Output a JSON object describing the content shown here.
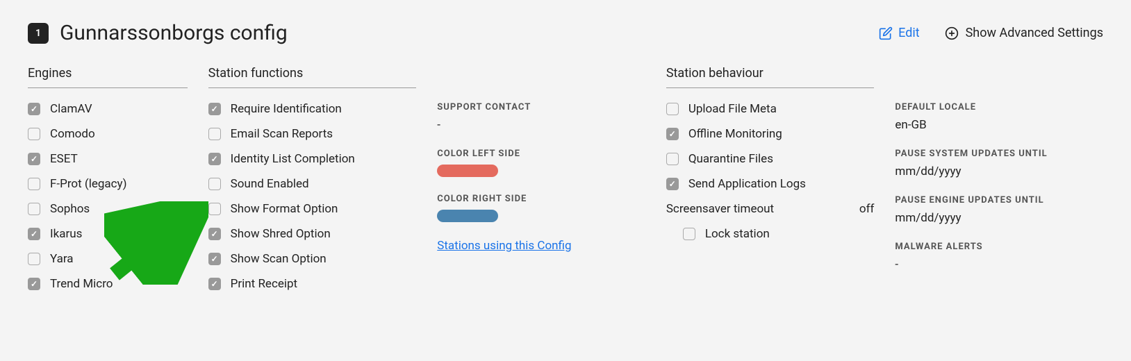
{
  "header": {
    "badge": "1",
    "title": "Gunnarssonborgs config",
    "edit_label": "Edit",
    "advanced_label": "Show Advanced Settings"
  },
  "engines": {
    "title": "Engines",
    "items": [
      {
        "label": "ClamAV",
        "checked": true
      },
      {
        "label": "Comodo",
        "checked": false
      },
      {
        "label": "ESET",
        "checked": true
      },
      {
        "label": "F-Prot (legacy)",
        "checked": false
      },
      {
        "label": "Sophos",
        "checked": false
      },
      {
        "label": "Ikarus",
        "checked": true
      },
      {
        "label": "Yara",
        "checked": false
      },
      {
        "label": "Trend Micro",
        "checked": true
      }
    ]
  },
  "functions": {
    "title": "Station functions",
    "items": [
      {
        "label": "Require Identification",
        "checked": true
      },
      {
        "label": "Email Scan Reports",
        "checked": false
      },
      {
        "label": "Identity List Completion",
        "checked": true
      },
      {
        "label": "Sound Enabled",
        "checked": false
      },
      {
        "label": "Show Format Option",
        "checked": false
      },
      {
        "label": "Show Shred Option",
        "checked": true
      },
      {
        "label": "Show Scan Option",
        "checked": true
      },
      {
        "label": "Print Receipt",
        "checked": true
      }
    ]
  },
  "details": {
    "support_label": "SUPPORT CONTACT",
    "support_value": "-",
    "color_left_label": "COLOR LEFT SIDE",
    "color_left_hex": "#e46a5e",
    "color_right_label": "COLOR RIGHT SIDE",
    "color_right_hex": "#4a84af",
    "stations_link": "Stations using this Config"
  },
  "behaviour": {
    "title": "Station behaviour",
    "checks": [
      {
        "label": "Upload File Meta",
        "checked": false
      },
      {
        "label": "Offline Monitoring",
        "checked": true
      },
      {
        "label": "Quarantine Files",
        "checked": false
      },
      {
        "label": "Send Application Logs",
        "checked": true
      }
    ],
    "screensaver_label": "Screensaver timeout",
    "screensaver_value": "off",
    "lock_station": {
      "label": "Lock station",
      "checked": false
    }
  },
  "settings": {
    "locale_label": "DEFAULT LOCALE",
    "locale_value": "en-GB",
    "pause_sys_label": "PAUSE SYSTEM UPDATES UNTIL",
    "pause_sys_value": "mm/dd/yyyy",
    "pause_eng_label": "PAUSE ENGINE UPDATES UNTIL",
    "pause_eng_value": "mm/dd/yyyy",
    "malware_label": "MALWARE ALERTS",
    "malware_value": "-"
  }
}
